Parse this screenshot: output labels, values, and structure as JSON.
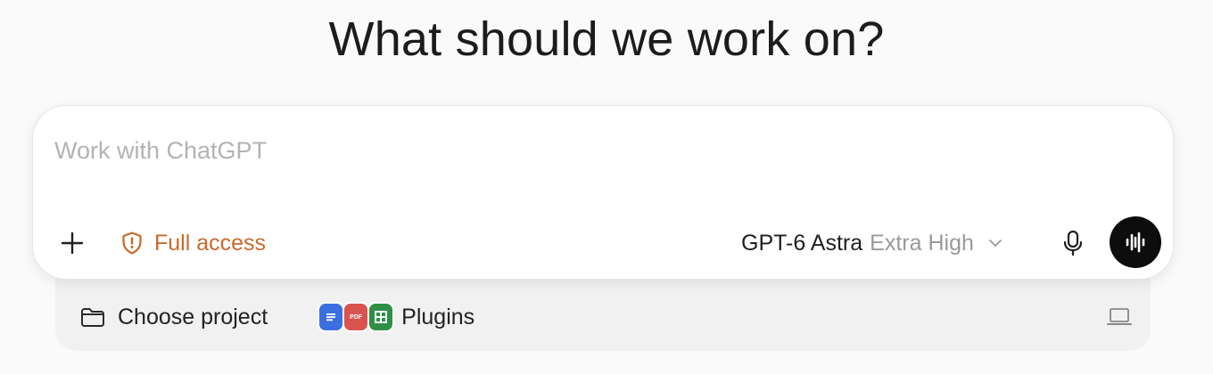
{
  "heading": "What should we work on?",
  "composer": {
    "placeholder": "Work with ChatGPT",
    "value": "",
    "access_label": "Full access",
    "model_name": "GPT-6 Astra",
    "model_effort": "Extra High"
  },
  "tray": {
    "project_label": "Choose project",
    "plugins_label": "Plugins",
    "plugin_pdf_text": "PDF"
  },
  "icons": {
    "plus": "plus-icon",
    "access": "shield-alert-icon",
    "dropdown": "chevron-down-icon",
    "mic": "microphone-icon",
    "voice": "voice-waveform-icon",
    "folder": "folder-icon",
    "docs": "docs-icon",
    "pdf": "pdf-icon",
    "sheets": "sheets-icon",
    "laptop": "laptop-icon"
  },
  "colors": {
    "background": "#fafafa",
    "access": "#c96a2b",
    "voice_button": "#0d0d0d",
    "docs": "#3b6fe0",
    "pdf": "#d9534f",
    "sheets": "#2f8f46"
  }
}
